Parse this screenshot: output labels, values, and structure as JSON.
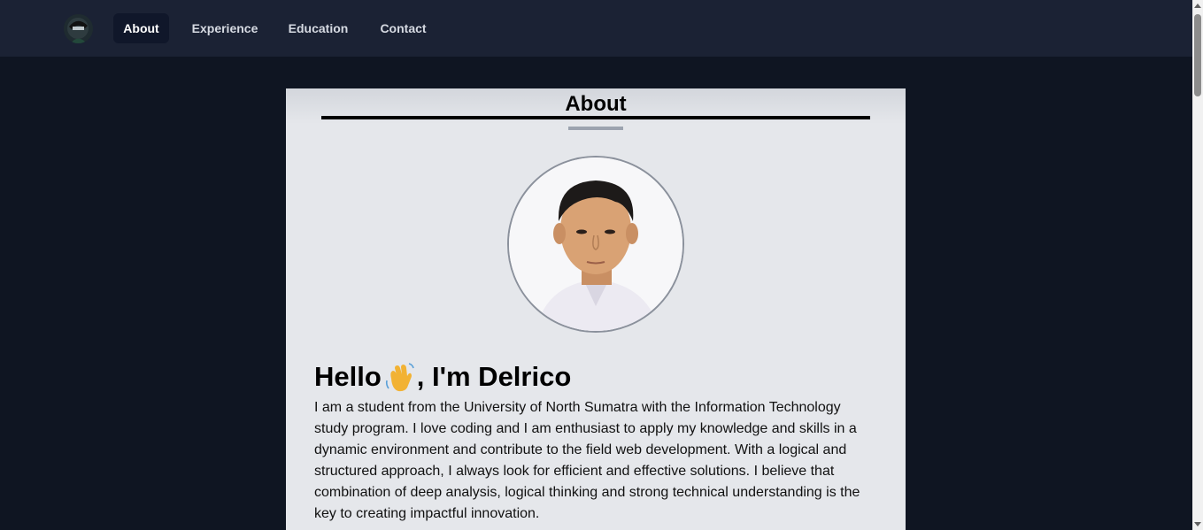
{
  "nav": {
    "items": [
      {
        "label": "About",
        "active": true
      },
      {
        "label": "Experience",
        "active": false
      },
      {
        "label": "Education",
        "active": false
      },
      {
        "label": "Contact",
        "active": false
      }
    ]
  },
  "about": {
    "title": "About",
    "greeting_prefix": "Hello",
    "greeting_suffix": ", I'm Delrico",
    "bio": "I am a student from the University of North Sumatra with the Information Technology study program. I love coding and I am enthusiast to apply my knowledge and skills in a dynamic environment and contribute to the field web development. With a logical and structured approach, I always look for efficient and effective solutions. I believe that combination of deep analysis, logical thinking and strong technical understanding is the key to creating impactful innovation."
  },
  "icons": {
    "logo": "anime-avatar-logo",
    "wave": "waving-hand-icon"
  },
  "colors": {
    "page_bg": "#0f1522",
    "navbar_bg": "#1b2234",
    "active_nav_bg": "#10172a",
    "card_bg": "#e5e7eb",
    "accent_underline": "#9ca3af"
  }
}
